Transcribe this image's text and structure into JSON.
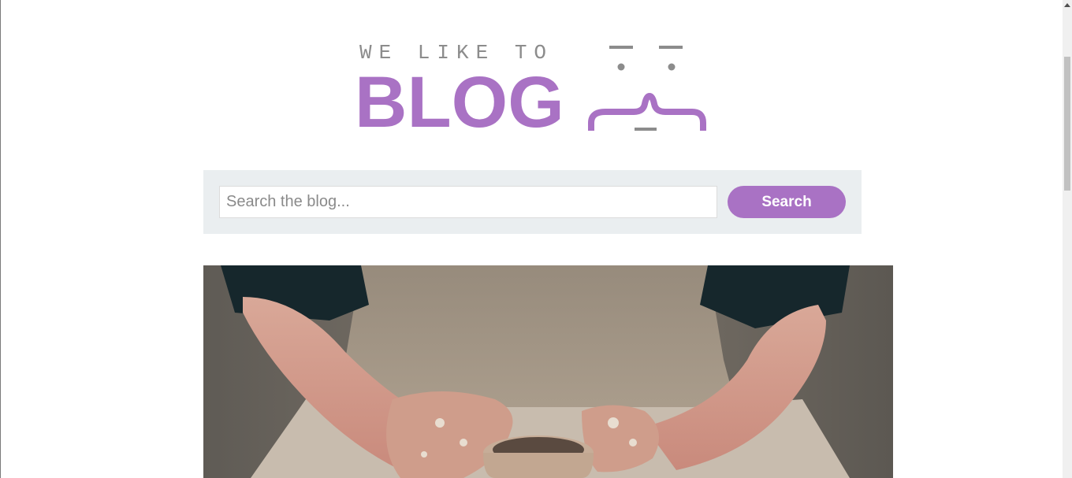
{
  "logo": {
    "tagline": "WE LIKE TO",
    "wordmark": "BLOG",
    "accent_color": "#a972c4",
    "tagline_color": "#8c8c8c"
  },
  "search": {
    "placeholder": "Search the blog...",
    "value": "",
    "button_label": "Search"
  },
  "hero": {
    "image": "pottery-wheel-hands-icon"
  },
  "colors": {
    "brand": "#a972c4",
    "search_panel_bg": "#eaeef0"
  }
}
